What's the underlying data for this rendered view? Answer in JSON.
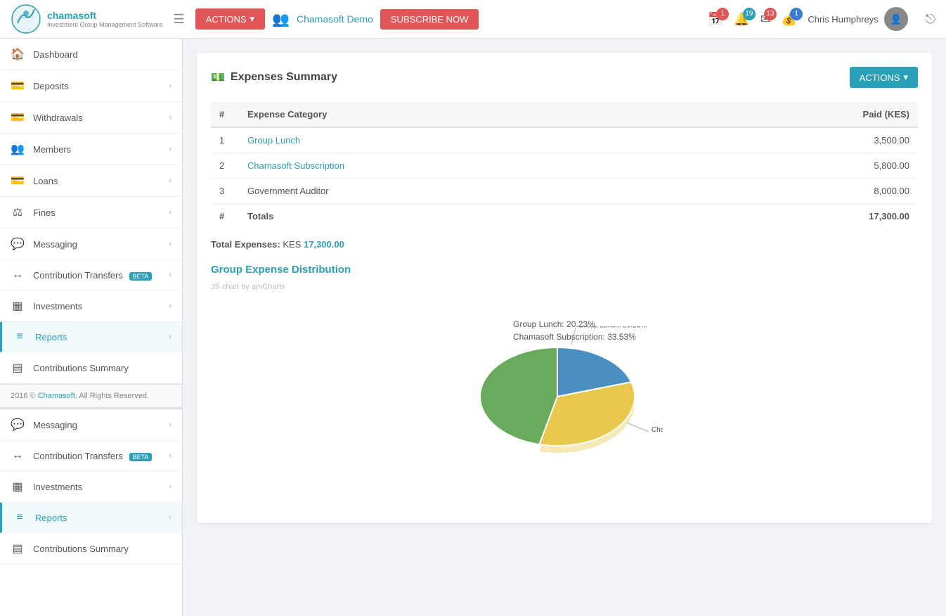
{
  "app": {
    "name": "chamasoft",
    "tagline": "Investment Group Management Software"
  },
  "navbar": {
    "actions_label": "ACTIONS",
    "group_name": "Chamasoft Demo",
    "subscribe_label": "SUBSCRIBE NOW",
    "badges": {
      "calendar": "1",
      "bell": "19",
      "mail": "13",
      "coin": "1"
    },
    "user_name": "Chris Humphreys"
  },
  "sidebar": {
    "items": [
      {
        "id": "dashboard",
        "label": "Dashboard",
        "icon": "🏠",
        "chevron": false,
        "active": false
      },
      {
        "id": "deposits",
        "label": "Deposits",
        "icon": "💳",
        "chevron": true,
        "active": false
      },
      {
        "id": "withdrawals",
        "label": "Withdrawals",
        "icon": "💳",
        "chevron": true,
        "active": false
      },
      {
        "id": "members",
        "label": "Members",
        "icon": "👥",
        "chevron": true,
        "active": false
      },
      {
        "id": "loans",
        "label": "Loans",
        "icon": "💳",
        "chevron": true,
        "active": false
      },
      {
        "id": "fines",
        "label": "Fines",
        "icon": "⚖",
        "chevron": true,
        "active": false
      },
      {
        "id": "messaging",
        "label": "Messaging",
        "icon": "💬",
        "chevron": true,
        "active": false
      },
      {
        "id": "contribution-transfers",
        "label": "Contribution Transfers",
        "icon": "↔",
        "beta": true,
        "chevron": true,
        "active": false
      },
      {
        "id": "investments",
        "label": "Investments",
        "icon": "▦",
        "chevron": true,
        "active": false
      },
      {
        "id": "reports",
        "label": "Reports",
        "icon": "≡",
        "chevron": true,
        "active": true
      }
    ],
    "footer": {
      "copyright": "2016 © ",
      "link_text": "Chamasoft",
      "suffix": ". All Rights Reserved."
    }
  },
  "sidebar2": {
    "items": [
      {
        "id": "messaging2",
        "label": "Messaging",
        "icon": "💬",
        "chevron": true,
        "active": false
      },
      {
        "id": "contribution-transfers2",
        "label": "Contribution Transfers",
        "icon": "↔",
        "beta": true,
        "chevron": true,
        "active": false
      },
      {
        "id": "investments2",
        "label": "Investments",
        "icon": "▦",
        "chevron": true,
        "active": false
      },
      {
        "id": "reports2",
        "label": "Reports",
        "icon": "≡",
        "chevron": true,
        "active": true
      }
    ]
  },
  "page": {
    "title": "Expenses Summary",
    "actions_label": "ACTIONS",
    "table": {
      "headers": [
        "#",
        "Expense Category",
        "Paid (KES)"
      ],
      "rows": [
        {
          "num": "1",
          "category": "Group Lunch",
          "amount": "3,500.00",
          "link": true
        },
        {
          "num": "2",
          "category": "Chamasoft Subscription",
          "amount": "5,800.00",
          "link": true
        },
        {
          "num": "3",
          "category": "Government Auditor",
          "amount": "8,000.00",
          "link": false
        }
      ],
      "total_row": {
        "num": "#",
        "label": "Totals",
        "amount": "17,300.00"
      }
    },
    "total_label": "Total Expenses:",
    "total_currency": "KES",
    "total_amount": "17,300.00",
    "chart_title": "Group Expense Distribution",
    "chart_note": "JS chart by amCharts",
    "chart_data": [
      {
        "label": "Group Lunch",
        "percent": "20.23",
        "color": "#4a8fc1",
        "slice_deg": 73
      },
      {
        "label": "Chamasoft Subscription",
        "percent": "33.53",
        "color": "#e8c84a",
        "slice_deg": 121
      },
      {
        "label": "Government Auditor",
        "percent": "46.24",
        "color": "#6aaa5c",
        "slice_deg": 166
      }
    ]
  }
}
